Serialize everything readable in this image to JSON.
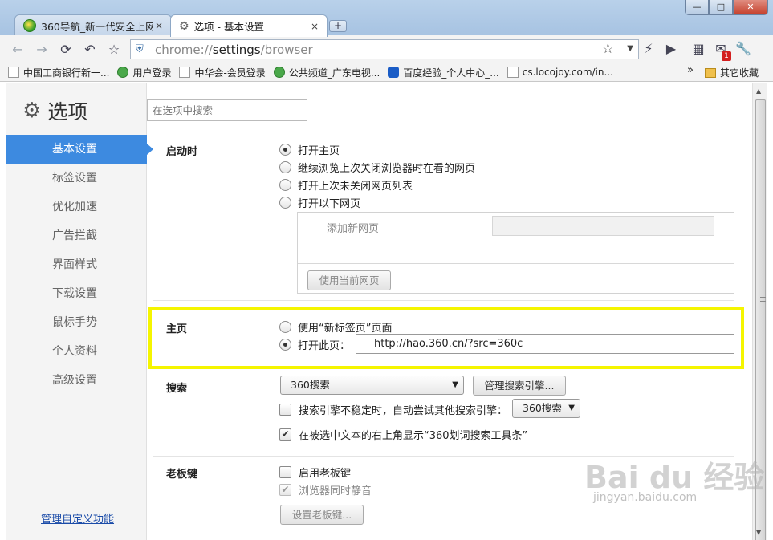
{
  "tabs": [
    {
      "title": "360导航_新一代安全上网",
      "close": "×"
    },
    {
      "title": "选项 - 基本设置",
      "close": "×"
    }
  ],
  "newtab_label": "+",
  "window": {
    "minimize": "—",
    "maximize": "□",
    "close": "✕"
  },
  "toolbar": {
    "url_scheme": "chrome://",
    "url_host": "settings",
    "url_path": "/browser",
    "badge": "1"
  },
  "bookmarks": [
    "中国工商银行新一...",
    "用户登录",
    "中华会-会员登录",
    "公共频道_广东电视...",
    "百度经验_个人中心_...",
    "cs.locojoy.com/in..."
  ],
  "bookmarks_more": "»",
  "bookmarks_other": "其它收藏",
  "settings": {
    "title": "选项",
    "search_placeholder": "在选项中搜索",
    "nav": [
      "基本设置",
      "标签设置",
      "优化加速",
      "广告拦截",
      "界面样式",
      "下载设置",
      "鼠标手势",
      "个人资料",
      "高级设置"
    ],
    "manage_link": "管理自定义功能"
  },
  "startup": {
    "label": "启动时",
    "options": [
      "打开主页",
      "继续浏览上次关闭浏览器时在看的网页",
      "打开上次未关闭网页列表",
      "打开以下网页"
    ],
    "add_page_label": "添加新网页",
    "use_current_button": "使用当前网页"
  },
  "homepage": {
    "label": "主页",
    "option_newtab": "使用“新标签页”页面",
    "option_open": "打开此页：",
    "url": "http://hao.360.cn/?src=360c"
  },
  "search": {
    "label": "搜索",
    "engine": "360搜索",
    "manage_button": "管理搜索引擎...",
    "fallback_label": "搜索引擎不稳定时，自动尝试其他搜索引擎：",
    "fallback_engine": "360搜索",
    "toolbar_label": "在被选中文本的右上角显示“360划词搜索工具条”"
  },
  "bosskey": {
    "label": "老板键",
    "enable_label": "启用老板键",
    "mute_label": "浏览器同时静音",
    "set_button": "设置老板键..."
  },
  "watermark": {
    "logo": "Bai du 经验",
    "url": "jingyan.baidu.com"
  }
}
